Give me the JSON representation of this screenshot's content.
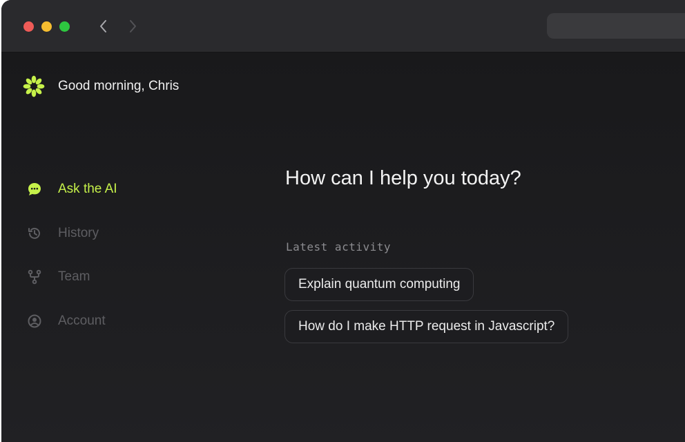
{
  "header": {
    "greeting": "Good morning, Chris"
  },
  "sidebar": {
    "items": [
      {
        "label": "Ask the AI",
        "icon": "chat-bubble-icon",
        "active": true
      },
      {
        "label": "History",
        "icon": "history-icon",
        "active": false
      },
      {
        "label": "Team",
        "icon": "branch-icon",
        "active": false
      },
      {
        "label": "Account",
        "icon": "user-circle-icon",
        "active": false
      }
    ]
  },
  "main": {
    "heading": "How can I help you today?",
    "latest_activity_label": "Latest activity",
    "activity": [
      "Explain quantum computing",
      "How do I make HTTP request in Javascript?"
    ]
  },
  "colors": {
    "accent": "#c6f14a",
    "background": "#1c1c1f",
    "titlebar": "#2a2a2d",
    "muted_text": "#5e5e62",
    "traffic_red": "#ef5b57",
    "traffic_yellow": "#f6bd30",
    "traffic_green": "#2ec740"
  }
}
